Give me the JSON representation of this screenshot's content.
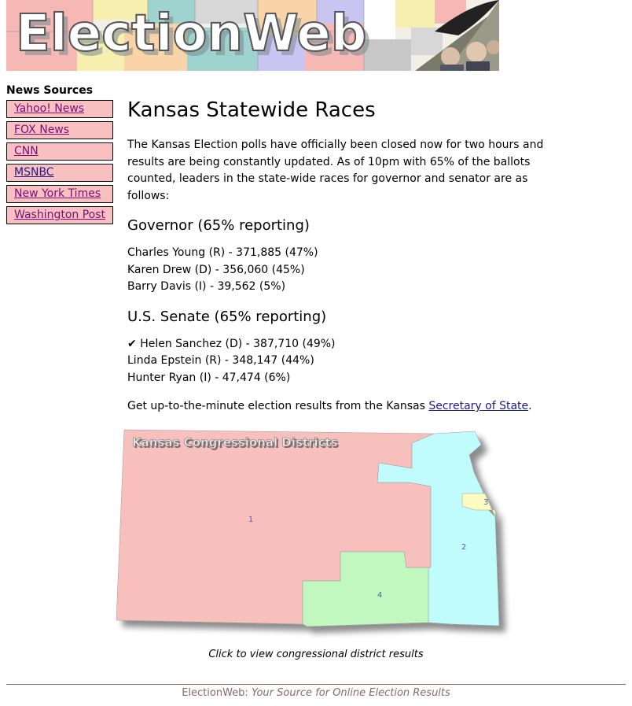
{
  "banner": {
    "title": "ElectionWeb"
  },
  "sidebar": {
    "heading": "News Sources",
    "items": [
      {
        "label": "Yahoo! News"
      },
      {
        "label": "FOX News"
      },
      {
        "label": "CNN"
      },
      {
        "label": "MSNBC"
      },
      {
        "label": "New York Times"
      },
      {
        "label": "Washington Post"
      }
    ]
  },
  "main": {
    "title": "Kansas Statewide Races",
    "intro": "The Kansas Election polls have officially been closed now for two hours and results are being constantly updated. As of 10pm with 65% of the ballots counted, leaders in the state-wide races for governor and senator are as follows:",
    "governor": {
      "heading": "Governor (65% reporting)",
      "results": [
        "Charles Young (R) - 371,885 (47%)",
        "Karen Drew (D) - 356,060 (45%)",
        "Barry Davis (I) - 39,562 (5%)"
      ]
    },
    "senate": {
      "heading": "U.S. Senate (65% reporting)",
      "winner_mark": "✔",
      "results": [
        "Helen Sanchez (D) - 387,710 (49%)",
        "Linda Epstein (R) - 348,147 (44%)",
        "Hunter Ryan (I) - 47,474 (6%)"
      ]
    },
    "link_text_before": "Get up-to-the-minute election results from the Kansas ",
    "link_label": "Secretary of State",
    "link_text_after": "."
  },
  "map": {
    "title": "Kansas Congressional Districts",
    "districts": [
      "1",
      "2",
      "3",
      "4"
    ],
    "colors": {
      "district1": "#f8c0bc",
      "district2": "#c0fcfc",
      "district3": "#fcfcc0",
      "district4": "#c0f8c0"
    },
    "caption": "Click to view congressional district results"
  },
  "footer": {
    "brand": "ElectionWeb: ",
    "tagline": "Your Source for Online Election Results"
  }
}
